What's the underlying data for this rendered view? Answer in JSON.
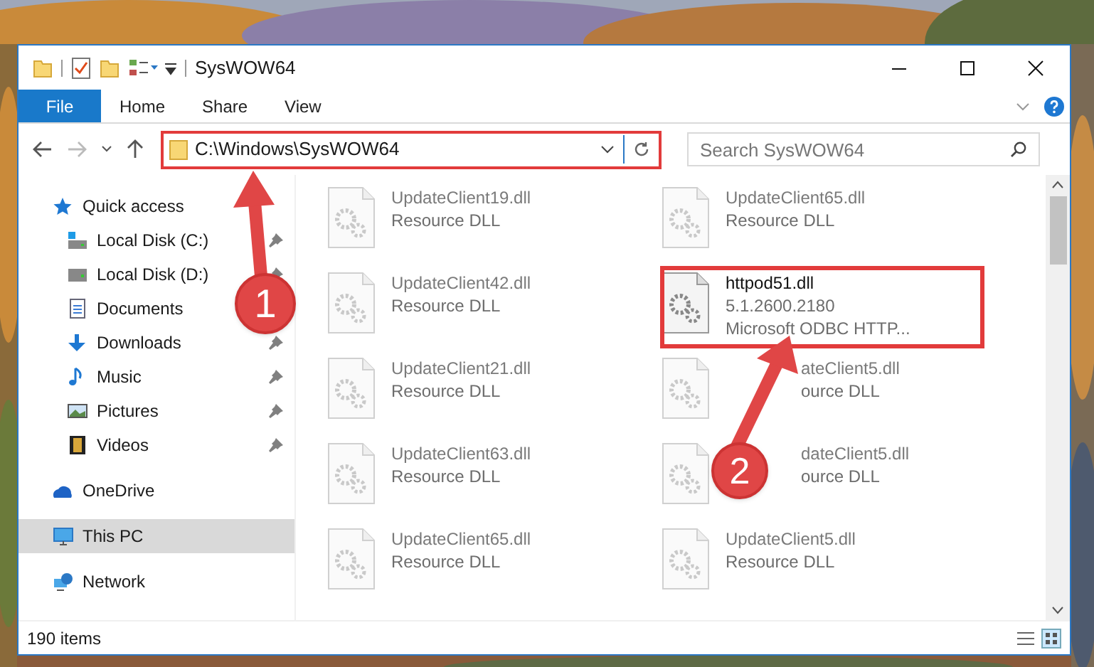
{
  "window": {
    "title": "SysWOW64"
  },
  "ribbon_tabs": [
    {
      "label": "File",
      "selected": true
    },
    {
      "label": "Home",
      "selected": false
    },
    {
      "label": "Share",
      "selected": false
    },
    {
      "label": "View",
      "selected": false
    }
  ],
  "address_bar": {
    "value": "C:\\Windows\\SysWOW64",
    "highlighted": true
  },
  "search": {
    "placeholder": "Search SysWOW64"
  },
  "sidebar": {
    "items": [
      {
        "label": "Quick access",
        "selected": false,
        "children": [
          {
            "label": "Local Disk (C:)",
            "selected": false,
            "pinned": true
          },
          {
            "label": "Local Disk (D:)",
            "selected": false,
            "pinned": true
          },
          {
            "label": "Documents",
            "selected": false
          },
          {
            "label": "Downloads",
            "selected": false,
            "pinned": true
          },
          {
            "label": "Music",
            "selected": false,
            "pinned": true
          },
          {
            "label": "Pictures",
            "selected": false,
            "pinned": true
          },
          {
            "label": "Videos",
            "selected": false,
            "pinned": true
          }
        ]
      },
      {
        "label": "OneDrive",
        "selected": false
      },
      {
        "label": "This PC",
        "selected": true
      },
      {
        "label": "Network",
        "selected": false
      }
    ]
  },
  "files": [
    {
      "name": "UpdateClient19.dll",
      "lines": [
        "Resource DLL"
      ],
      "blurred": true,
      "highlighted": false
    },
    {
      "name": "UpdateClient65.dll",
      "lines": [
        "Resource DLL"
      ],
      "blurred": true,
      "highlighted": false
    },
    {
      "name": "UpdateClient42.dll",
      "lines": [
        "Resource DLL"
      ],
      "blurred": true,
      "highlighted": false
    },
    {
      "name": "httpod51.dll",
      "lines": [
        "5.1.2600.2180",
        "Microsoft ODBC HTTP..."
      ],
      "blurred": false,
      "highlighted": true
    },
    {
      "name": "UpdateClient21.dll",
      "lines": [
        "Resource DLL"
      ],
      "blurred": true,
      "highlighted": false
    },
    {
      "name": "ateClient5.dll",
      "lines": [
        "ource DLL"
      ],
      "blurred": true,
      "highlighted": false,
      "covered": true
    },
    {
      "name": "UpdateClient63.dll",
      "lines": [
        "Resource DLL"
      ],
      "blurred": true,
      "highlighted": false
    },
    {
      "name": "dateClient5.dll",
      "lines": [
        "ource DLL"
      ],
      "blurred": true,
      "highlighted": false,
      "covered": true
    },
    {
      "name": "UpdateClient65.dll",
      "lines": [
        "Resource DLL"
      ],
      "blurred": true,
      "highlighted": false
    },
    {
      "name": "UpdateClient5.dll",
      "lines": [
        "Resource DLL"
      ],
      "blurred": true,
      "highlighted": false
    }
  ],
  "status_bar": {
    "item_count": "190 items"
  },
  "annotations": [
    {
      "label": "1"
    },
    {
      "label": "2"
    }
  ]
}
